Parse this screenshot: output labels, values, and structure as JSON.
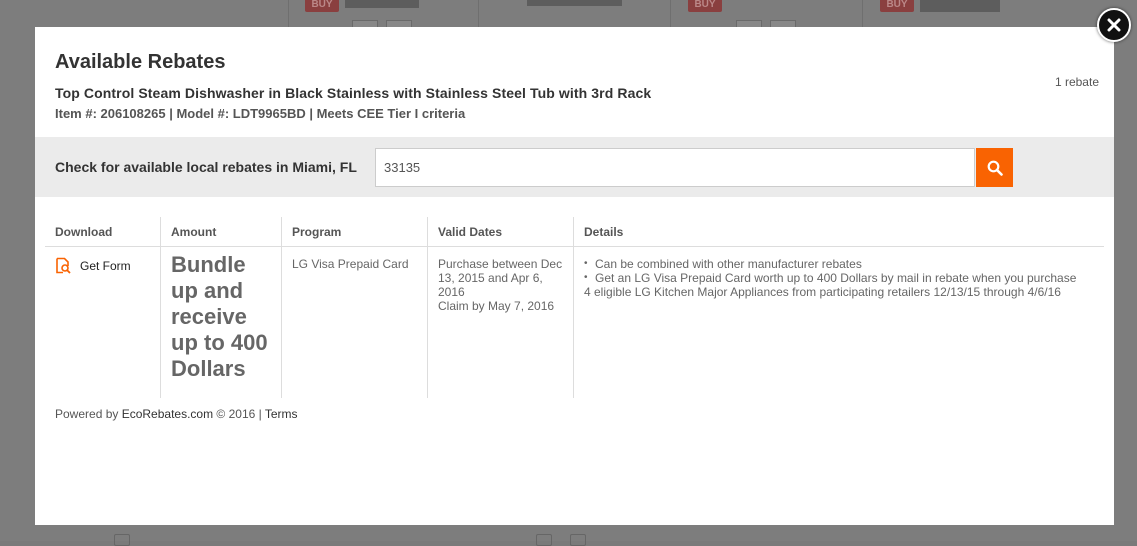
{
  "background": {
    "buy_badge": "BUY"
  },
  "modal": {
    "title": "Available Rebates",
    "product_name": "Top Control Steam Dishwasher in Black Stainless with Stainless Steel Tub with 3rd Rack",
    "product_meta": "Item #: 206108265 | Model #: LDT9965BD | Meets CEE Tier I criteria",
    "rebate_count": "1 rebate",
    "search_label": "Check for available local rebates in Miami, FL",
    "zip_value": "33135",
    "table": {
      "headers": [
        "Download",
        "Amount",
        "Program",
        "Valid Dates",
        "Details"
      ],
      "row": {
        "download_label": "Get Form",
        "amount": "Bundle up and receive up to 400 Dollars",
        "program": "LG Visa Prepaid Card",
        "dates_line1": "Purchase between Dec 13, 2015 and Apr 6, 2016",
        "dates_line2": "Claim by May 7, 2016",
        "detail_1": "Can be combined with other manufacturer rebates",
        "detail_2": "Get an LG Visa Prepaid Card worth up to 400 Dollars by mail in rebate when you purchase",
        "detail_2_cont": "4 eligible LG Kitchen Major Appliances from participating retailers 12/13/15 through 4/6/16"
      }
    },
    "footer": {
      "powered_by": "Powered by ",
      "brand": "EcoRebates.com",
      "copyright": " © 2016 | ",
      "terms": "Terms"
    }
  },
  "colors": {
    "accent": "#f96302",
    "overlay": "#7d7d7d"
  }
}
